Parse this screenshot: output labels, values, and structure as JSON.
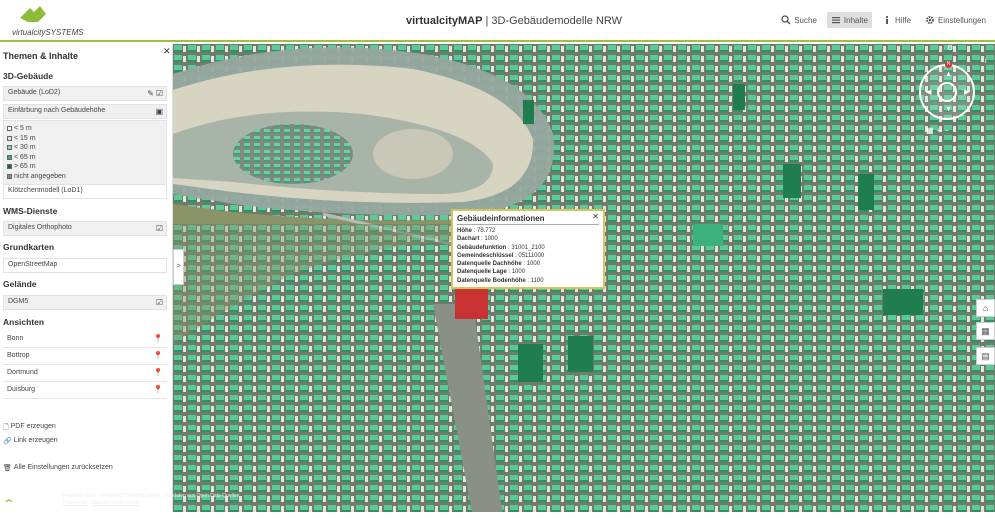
{
  "header": {
    "logo_text": "virtualcitySYSTEMS",
    "app_name": "virtualcityMAP",
    "app_subtitle": "3D-Gebäudemodelle NRW",
    "nav": [
      {
        "label": "Suche",
        "icon": "search-icon"
      },
      {
        "label": "Inhalte",
        "icon": "menu-icon"
      },
      {
        "label": "Hilfe",
        "icon": "info-icon"
      },
      {
        "label": "Einstellungen",
        "icon": "gear-icon"
      }
    ]
  },
  "sidebar": {
    "title": "Themen & Inhalte",
    "sec_3d": "3D-Gebäude",
    "gebaeude_label": "Gebäude (LoD2)",
    "einfaerbung_label": "Einfärbung nach Gebäudehöhe",
    "legend": [
      {
        "label": "< 5 m",
        "color": "#ffffff"
      },
      {
        "label": "< 15 m",
        "color": "#c8f0e0"
      },
      {
        "label": "< 30 m",
        "color": "#7ed8b4"
      },
      {
        "label": "< 65 m",
        "color": "#3cb07e"
      },
      {
        "label": "> 65 m",
        "color": "#146e3c"
      },
      {
        "label": "nicht angegeben",
        "color": "#888888"
      }
    ],
    "kloetzchen_label": "Klötzchenmodell (LoD1)",
    "sec_wms": "WMS-Dienste",
    "orthophoto_label": "Digitales Orthophoto",
    "sec_grundkarten": "Grundkarten",
    "osm_label": "OpenStreetMap",
    "sec_gelaende": "Gelände",
    "dgm_label": "DGM5",
    "sec_ansichten": "Ansichten",
    "places": [
      "Bonn",
      "Bottrop",
      "Dortmund",
      "Duisburg"
    ],
    "pdf_label": "PDF erzeugen",
    "link_label": "Link erzeugen",
    "reset_label": "Alle Einstellungen zurücksetzen"
  },
  "popup": {
    "title": "Gebäudeinformationen",
    "rows": [
      {
        "key": "Höhe",
        "value": "78.772"
      },
      {
        "key": "Dachart",
        "value": "1000"
      },
      {
        "key": "Gebäudefunktion",
        "value": "31001_2100"
      },
      {
        "key": "Gemeindeschlüssel",
        "value": "05111000"
      },
      {
        "key": "Datenquelle Dachhöhe",
        "value": "1000"
      },
      {
        "key": "Datenquelle Lage",
        "value": "1000"
      },
      {
        "key": "Datenquelle Bodenhöhe",
        "value": "1100"
      }
    ]
  },
  "footer": {
    "cesium_label": "CESIUM",
    "credit_line": "Realisiert durch virtualcitySYSTEMS GmbH | Geodaten aus Open Data Quellen",
    "impressum": "Impressum",
    "datenschutz": "Datenschutzhinweise"
  },
  "colors": {
    "accent": "#9bc23c",
    "building": "#4fc594",
    "popup_border": "#d2c65a",
    "selected_building": "#c83232"
  }
}
